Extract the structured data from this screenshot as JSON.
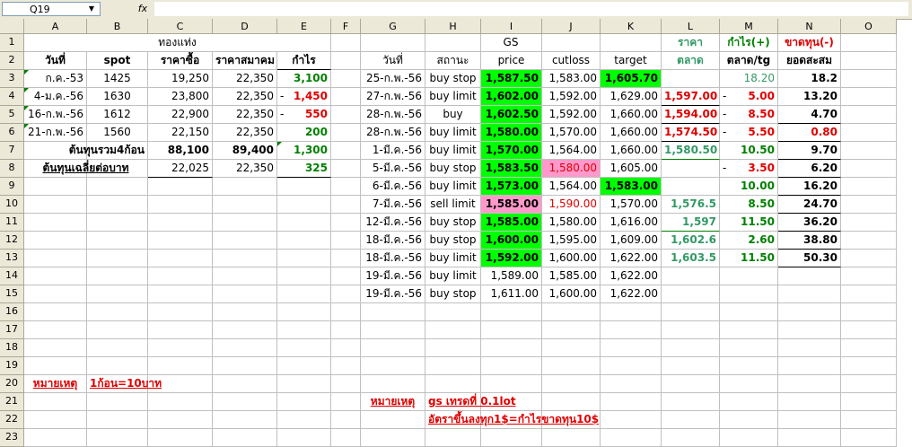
{
  "formula_bar": {
    "name_box": "Q19",
    "fx": "fx",
    "formula": ""
  },
  "columns": [
    "A",
    "B",
    "C",
    "D",
    "E",
    "F",
    "G",
    "H",
    "I",
    "J",
    "K",
    "L",
    "M",
    "N",
    "O"
  ],
  "rows": [
    "1",
    "2",
    "3",
    "4",
    "5",
    "6",
    "7",
    "8",
    "9",
    "10",
    "11",
    "12",
    "13",
    "14",
    "15",
    "16",
    "17",
    "18",
    "19",
    "20",
    "21",
    "22",
    "23"
  ],
  "left": {
    "title": "ทองแท่ง",
    "headers": [
      "วันที่",
      "spot",
      "ราคาซื้อ",
      "ราคาสมาคม",
      "กำไร"
    ],
    "rows": [
      [
        "ก.ค.-53",
        "1425",
        "19,250",
        "22,350",
        "3,100"
      ],
      [
        "4-ม.ค.-56",
        "1630",
        "23,800",
        "22,350",
        "1,450"
      ],
      [
        "16-ก.พ.-56",
        "1612",
        "22,900",
        "22,350",
        "550"
      ],
      [
        "21-ก.พ.-56",
        "1560",
        "22,150",
        "22,350",
        "200"
      ]
    ],
    "minus": "-",
    "total_label": "ต้นทุนรวม4ก้อน",
    "total_buy": "88,100",
    "total_assoc": "89,400",
    "total_profit": "1,300",
    "avg_label": "ต้นทุนเฉลี่ยต่อบาท",
    "avg_buy": "22,025",
    "avg_assoc": "22,350",
    "avg_profit": "325",
    "note_label": "หมายเหตุ",
    "note_text": "1ก้อน=10บาท"
  },
  "right": {
    "title": "GS",
    "headers": [
      "วันที่",
      "สถานะ",
      "price",
      "cutloss",
      "target"
    ],
    "col_l_header1": "ราคา",
    "col_l_header2": "ตลาด",
    "col_m_header1": "กำไร(+)",
    "col_m_header2": "ตลาด/tg",
    "col_n_header1": "ขาดทุน(-)",
    "col_n_header2": "ยอดสะสม",
    "rows": [
      [
        "25-ก.พ.-56",
        "buy stop",
        "1,587.50",
        "1,583.00",
        "1,605.70",
        "",
        "",
        "18.20",
        "18.2"
      ],
      [
        "27-ก.พ.-56",
        "buy limit",
        "1,602.00",
        "1,592.00",
        "1,629.00",
        "1,597.00",
        "-",
        "5.00",
        "13.20"
      ],
      [
        "28-ก.พ.-56",
        "buy",
        "1,602.50",
        "1,592.00",
        "1,660.00",
        "1,594.00",
        "-",
        "8.50",
        "4.70"
      ],
      [
        "28-ก.พ.-56",
        "buy limit",
        "1,580.00",
        "1,570.00",
        "1,660.00",
        "1,574.50",
        "-",
        "5.50",
        "0.80"
      ],
      [
        "1-มี.ค.-56",
        "buy limit",
        "1,570.00",
        "1,564.00",
        "1,660.00",
        "1,580.50",
        "",
        "10.50",
        "9.70"
      ],
      [
        "5-มี.ค.-56",
        "buy stop",
        "1,583.50",
        "1,580.00",
        "1,605.00",
        "",
        "-",
        "3.50",
        "6.20"
      ],
      [
        "6-มี.ค.-56",
        "buy limit",
        "1,573.00",
        "1,564.00",
        "1,583.00",
        "",
        "",
        "10.00",
        "16.20"
      ],
      [
        "7-มี.ค.-56",
        "sell limit",
        "1,585.00",
        "1,590.00",
        "1,570.00",
        "1,576.5",
        "",
        "8.50",
        "24.70"
      ],
      [
        "12-มี.ค.-56",
        "buy stop",
        "1,585.00",
        "1,580.00",
        "1,616.00",
        "1,597",
        "",
        "11.50",
        "36.20"
      ],
      [
        "18-มี.ค.-56",
        "buy stop",
        "1,600.00",
        "1,595.00",
        "1,609.00",
        "1,602.6",
        "",
        "2.60",
        "38.80"
      ],
      [
        "18-มี.ค.-56",
        "buy limit",
        "1,592.00",
        "1,600.00",
        "1,622.00",
        "1,603.5",
        "",
        "11.50",
        "50.30"
      ],
      [
        "19-มี.ค.-56",
        "buy limit",
        "1,589.00",
        "1,585.00",
        "1,622.00",
        "",
        "",
        "",
        ""
      ],
      [
        "19-มี.ค.-56",
        "buy stop",
        "1,611.00",
        "1,600.00",
        "1,622.00",
        "",
        "",
        "",
        ""
      ]
    ],
    "note_label": "หมายเหตุ",
    "note_line1": "gs เทรดที่ 0.1lot",
    "note_line2": "อัตราขึ้นลงทุก1$=กำไรขาดทุน10$"
  },
  "colors": {
    "green_fill": "#00ff00",
    "pink_fill": "#ff99cc",
    "red_text": "#e00000",
    "green_text": "#008000",
    "teal_text": "#339966"
  }
}
